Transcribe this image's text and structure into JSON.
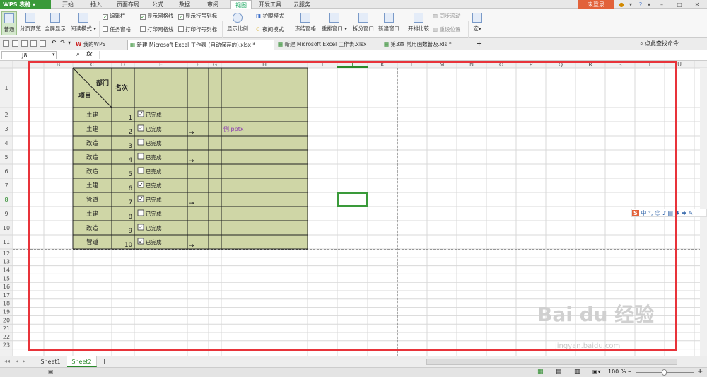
{
  "app": {
    "logo": "WPS 表格",
    "login": "未登录",
    "menu": [
      "开始",
      "插入",
      "页面布局",
      "公式",
      "数据",
      "审阅",
      "视图",
      "开发工具",
      "云服务"
    ],
    "active_menu": "视图"
  },
  "ribbon": {
    "view_buttons": [
      "普通",
      "分页预览",
      "全屏显示",
      "阅读模式"
    ],
    "checks": [
      {
        "label": "编辑栏",
        "checked": true
      },
      {
        "label": "显示网格线",
        "checked": true
      },
      {
        "label": "显示行号列标",
        "checked": true
      },
      {
        "label": "任务窗格",
        "checked": false
      },
      {
        "label": "打印网格线",
        "checked": false
      },
      {
        "label": "打印行号列标",
        "checked": false
      }
    ],
    "zoom": "显示比例",
    "eye": "护眼模式",
    "night": "夜间模式",
    "freeze": "冻结窗格",
    "arrange": "重排窗口",
    "split": "拆分窗口",
    "new_window": "新建窗口",
    "side_by_side": "开排比较",
    "sync_scroll": "同步滚动",
    "reset_pos": "重设位置",
    "macro": "宏"
  },
  "doc_tabs": [
    "我的WPS",
    "新建 Microsoft Excel 工作表 (自动保存的).xlsx *",
    "新建 Microsoft Excel 工作表.xlsx",
    "第3章 常用函数普及.xls *"
  ],
  "search_hint": "点此查找命令",
  "formula": {
    "cell_ref": "J8",
    "fx": "fx"
  },
  "columns": [
    "B",
    "C",
    "D",
    "E",
    "F",
    "G",
    "H",
    "I",
    "J",
    "K",
    "L",
    "M",
    "N",
    "O",
    "P",
    "Q",
    "R",
    "S",
    "T",
    "U"
  ],
  "header": {
    "dept": "部门",
    "item": "项目",
    "rank": "名次"
  },
  "rows": [
    {
      "item": "土建",
      "rank": "1",
      "status": "已完成",
      "checked": true,
      "arrow": "",
      "link": ""
    },
    {
      "item": "土建",
      "rank": "2",
      "status": "已完成",
      "checked": true,
      "arrow": "→",
      "link": "例.pptx"
    },
    {
      "item": "改造",
      "rank": "3",
      "status": "已完成",
      "checked": false,
      "arrow": "",
      "link": ""
    },
    {
      "item": "改造",
      "rank": "4",
      "status": "已完成",
      "checked": false,
      "arrow": "→",
      "link": ""
    },
    {
      "item": "改造",
      "rank": "5",
      "status": "已完成",
      "checked": false,
      "arrow": "",
      "link": ""
    },
    {
      "item": "土建",
      "rank": "6",
      "status": "已完成",
      "checked": true,
      "arrow": "",
      "link": ""
    },
    {
      "item": "管道",
      "rank": "7",
      "status": "已完成",
      "checked": true,
      "arrow": "→",
      "link": ""
    },
    {
      "item": "土建",
      "rank": "8",
      "status": "已完成",
      "checked": false,
      "arrow": "",
      "link": ""
    },
    {
      "item": "改造",
      "rank": "9",
      "status": "已完成",
      "checked": true,
      "arrow": "",
      "link": ""
    },
    {
      "item": "管道",
      "rank": "10",
      "status": "已完成",
      "checked": true,
      "arrow": "→",
      "link": ""
    }
  ],
  "row_numbers": [
    "1",
    "2",
    "3",
    "4",
    "5",
    "6",
    "7",
    "8",
    "9",
    "10",
    "11",
    "12",
    "13",
    "14",
    "15",
    "16",
    "17",
    "18",
    "19",
    "20",
    "21",
    "22",
    "23"
  ],
  "sheets": [
    "Sheet1",
    "Sheet2"
  ],
  "active_sheet": "Sheet2",
  "zoom_level": "100 %",
  "ime": "中",
  "watermark": "Bai du 经验",
  "watermark_url": "jingyan.baidu.com",
  "colors": {
    "table_fill": "#cfd6a6",
    "selected": "#3a9a3a",
    "red_frame": "#e8333a",
    "brand": "#3a9a3a"
  }
}
